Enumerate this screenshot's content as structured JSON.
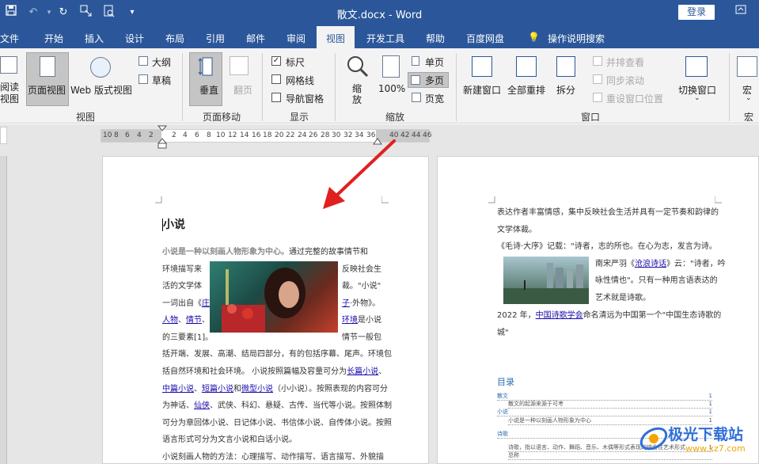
{
  "title_bar": {
    "doc_title": "散文.docx  -  Word",
    "login_label": "登录"
  },
  "tabs": [
    "文件",
    "开始",
    "插入",
    "设计",
    "布局",
    "引用",
    "邮件",
    "审阅",
    "视图",
    "开发工具",
    "帮助",
    "百度网盘",
    "操作说明搜索"
  ],
  "ribbon": {
    "views": {
      "read_mode": "阅读\n视图",
      "print_layout": "页面视图",
      "web_layout": "Web 版式视图",
      "outline": "大纲",
      "draft": "草稿",
      "group": "视图"
    },
    "page_move": {
      "vertical": "垂直",
      "side_to_side": "翻页",
      "group": "页面移动"
    },
    "show": {
      "ruler": "标尺",
      "gridlines": "网格线",
      "nav_pane": "导航窗格",
      "group": "显示"
    },
    "zoom": {
      "zoom": "缩放",
      "hundred": "100%",
      "one_page": "单页",
      "multiple_pages": "多页",
      "page_width": "页宽",
      "group": "缩放"
    },
    "window": {
      "new_window": "新建窗口",
      "arrange_all": "全部重排",
      "split": "拆分",
      "view_side": "并排查看",
      "sync_scroll": "同步滚动",
      "reset_pos": "重设窗口位置",
      "switch_window": "切换窗口",
      "group": "窗口"
    },
    "macros": {
      "macros": "宏",
      "group": "宏"
    }
  },
  "ruler": {
    "left_numbers": [
      "10",
      "8",
      "6",
      "4",
      "2"
    ],
    "right_numbers": [
      "2",
      "4",
      "6",
      "8",
      "10",
      "12",
      "14",
      "16",
      "18",
      "20",
      "22",
      "24",
      "26",
      "28",
      "30",
      "32",
      "34",
      "36"
    ],
    "tail_numbers": [
      "40",
      "42",
      "44",
      "46"
    ]
  },
  "page1": {
    "heading": "小说",
    "lines": [
      {
        "parts": [
          {
            "t": "小说是一种以刻画人物形象为中心",
            "c": "bold"
          },
          {
            "t": "。通过完整的故事情节和"
          }
        ]
      },
      {
        "parts": [
          {
            "t": "环境描写来"
          }
        ],
        "right": [
          {
            "t": "反映社会生"
          }
        ]
      },
      {
        "parts": [
          {
            "t": "活的文学体"
          }
        ],
        "right": [
          {
            "t": "裁。\"小说\""
          }
        ]
      },
      {
        "parts": [
          {
            "t": "一词出自《"
          },
          {
            "t": "庄",
            "c": "lnk"
          }
        ],
        "right": [
          {
            "t": "子",
            "c": "lnk"
          },
          {
            "t": "·外物》。"
          }
        ]
      },
      {
        "parts": [
          {
            "t": "人物",
            "c": "lnk"
          },
          {
            "t": "、"
          },
          {
            "t": "情节",
            "c": "lnk"
          },
          {
            "t": "、"
          }
        ],
        "right": [
          {
            "t": "环境",
            "c": "lnk"
          },
          {
            "t": "是小说"
          }
        ]
      },
      {
        "parts": [
          {
            "t": "的三要素[1]。"
          }
        ],
        "right": [
          {
            "t": "情节一般包"
          }
        ]
      },
      {
        "parts": [
          {
            "t": "括开端、发展、高潮、结局四部分，有的包括序幕、尾声。环境包"
          }
        ]
      },
      {
        "parts": [
          {
            "t": "括自然环境和社会环境。 小说按照篇幅及容量可分为"
          },
          {
            "t": "长篇小说",
            "c": "lnk"
          },
          {
            "t": "、"
          }
        ]
      },
      {
        "parts": [
          {
            "t": "中篇小说",
            "c": "lnk"
          },
          {
            "t": "、"
          },
          {
            "t": "短篇小说",
            "c": "lnk"
          },
          {
            "t": "和"
          },
          {
            "t": "微型小说",
            "c": "lnk"
          },
          {
            "t": "（小小说）。按照表现的内容可分"
          }
        ]
      },
      {
        "parts": [
          {
            "t": "为神话、"
          },
          {
            "t": "仙侠",
            "c": "lnk"
          },
          {
            "t": "、武侠、科幻、悬疑、古传、当代等小说。按照体制"
          }
        ]
      },
      {
        "parts": [
          {
            "t": "可分为章回体小说、日记体小说、书信体小说、自传体小说。按照"
          }
        ]
      },
      {
        "parts": [
          {
            "t": "语言形式可分为文言小说和白话小说。"
          }
        ]
      },
      {
        "parts": [
          {
            "t": "小说刻画人物的方法：心理描写、动作描写、语言描写、外貌描"
          }
        ]
      }
    ]
  },
  "page2": {
    "lines_top": [
      {
        "parts": [
          {
            "t": "表达作者丰富情感，集中反映社会生活并具有一定节奏和韵律的"
          }
        ]
      },
      {
        "parts": [
          {
            "t": "文学体裁。"
          }
        ]
      },
      {
        "parts": [
          {
            "t": "《毛诗·大序》记载：\"诗者，志的所也。在心为志，发言为诗。"
          }
        ]
      }
    ],
    "beside_image": [
      {
        "parts": [
          {
            "t": "南宋严羽《"
          },
          {
            "t": "沧浪诗话",
            "c": "lnk"
          },
          {
            "t": "》云：\"诗者，吟"
          }
        ]
      },
      {
        "parts": [
          {
            "t": "咏性情也\"。只有一种用言语表达的"
          }
        ]
      },
      {
        "parts": [
          {
            "t": "艺术就是诗歌。"
          }
        ]
      }
    ],
    "lines_bottom": [
      {
        "parts": [
          {
            "t": "2022 年，"
          },
          {
            "t": "中国诗歌学会",
            "c": "lnk"
          },
          {
            "t": "命名清远为中国第一个\"中国生态诗歌的"
          }
        ]
      },
      {
        "parts": [
          {
            "t": "城\""
          }
        ]
      }
    ],
    "toc_title": "目录",
    "toc": [
      {
        "t": "散文",
        "p": "1",
        "indent": 0
      },
      {
        "t": "散文的起源来源于可考",
        "p": "1",
        "indent": 1
      },
      {
        "t": "小说",
        "p": "1",
        "indent": 0
      },
      {
        "t": "小说是一种以刻画人物形象为中心",
        "p": "1",
        "indent": 1
      },
      {
        "t": "诗歌",
        "p": "1",
        "indent": 0
      },
      {
        "t": "诗歌，指以语言、动作、舞蹈、音乐、木偶等形式表现的综合性艺术形式",
        "p": "1",
        "indent": 1
      },
      {
        "t": "总称",
        "p": "",
        "indent": 1
      }
    ]
  },
  "watermark": {
    "cn": "极光下载站",
    "url": "www.xz7.com"
  },
  "colors": {
    "brand": "#2b579a",
    "arrow": "#e02020",
    "link": "#1a0dab"
  }
}
